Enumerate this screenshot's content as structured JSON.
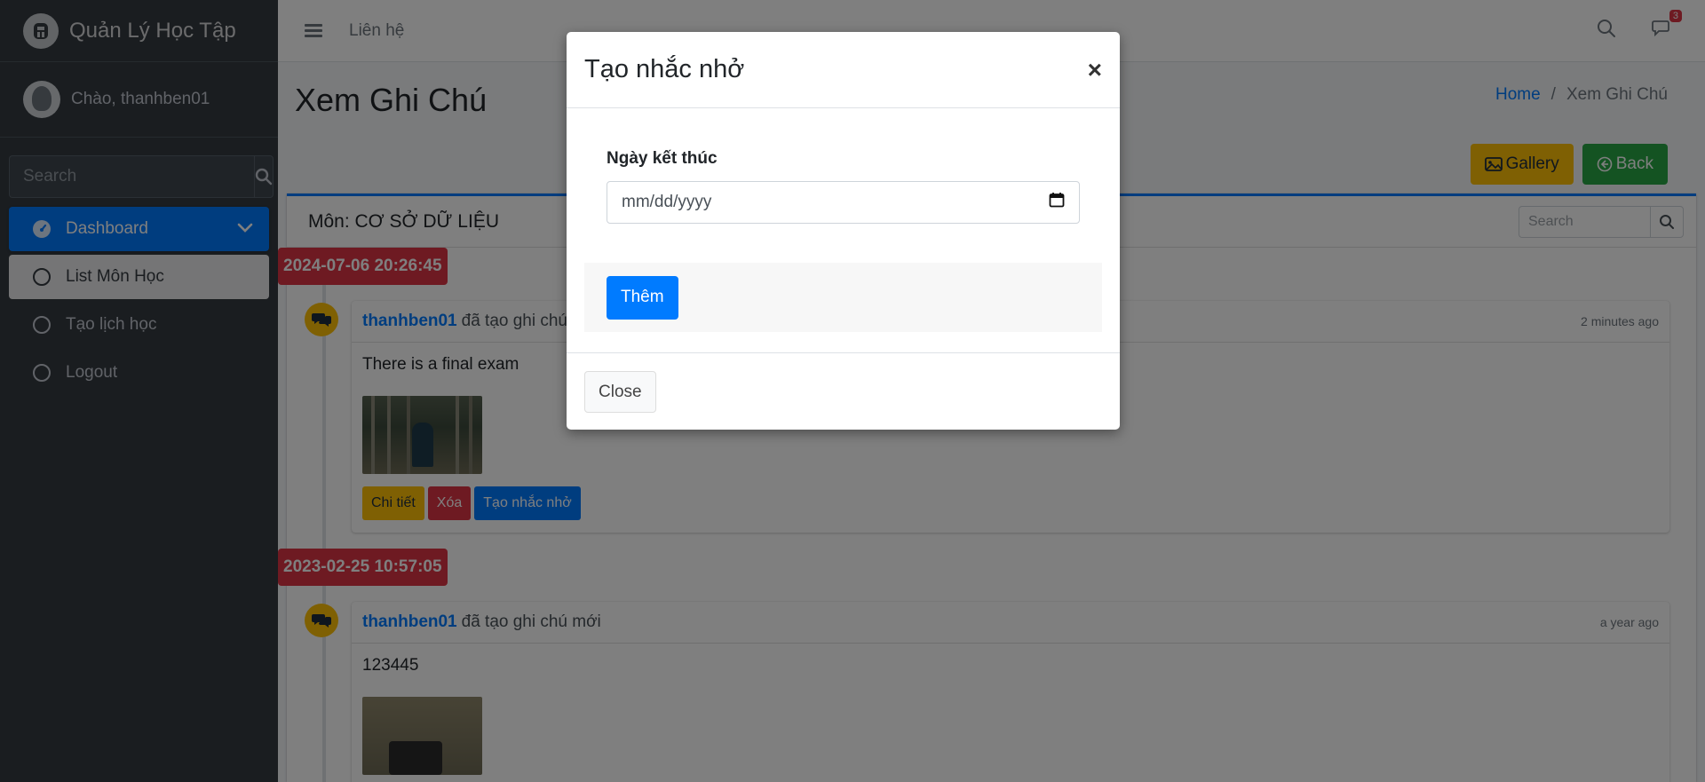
{
  "brand": {
    "name": "Quản Lý Học Tập"
  },
  "user": {
    "greeting": "Chào, thanhben01"
  },
  "sidebar": {
    "search_placeholder": "Search",
    "items": [
      {
        "label": "Dashboard",
        "icon": "tachometer-icon",
        "state": "active"
      },
      {
        "label": "List Môn Học",
        "icon": "circle-icon",
        "state": "selected"
      },
      {
        "label": "Tạo lịch học",
        "icon": "circle-icon",
        "state": "normal"
      },
      {
        "label": "Logout",
        "icon": "circle-icon",
        "state": "normal"
      }
    ]
  },
  "topbar": {
    "contact_label": "Liên hệ",
    "message_count": "3"
  },
  "page": {
    "title": "Xem Ghi Chú",
    "breadcrumb": {
      "home": "Home",
      "separator": "/",
      "current": "Xem Ghi Chú"
    },
    "gallery_label": "Gallery",
    "back_label": "Back"
  },
  "card": {
    "title": "Môn: CƠ SỞ DỮ LIỆU",
    "search_placeholder": "Search"
  },
  "timeline": [
    {
      "time_label": "2024-07-06 20:26:45",
      "author": "thanhben01",
      "action": "đã tạo ghi chú mới",
      "ago": "2 minutes ago",
      "body": "There is a final exam",
      "buttons": {
        "detail": "Chi tiết",
        "delete": "Xóa",
        "reminder": "Tạo nhắc nhở"
      }
    },
    {
      "time_label": "2023-02-25 10:57:05",
      "author": "thanhben01",
      "action": "đã tạo ghi chú mới",
      "ago": "a year ago",
      "body": "123445"
    }
  ],
  "modal": {
    "title": "Tạo nhắc nhở",
    "close_symbol": "×",
    "field_label": "Ngày kết thúc",
    "date_placeholder": "mm/dd/yyyy",
    "submit_label": "Thêm",
    "close_label": "Close"
  },
  "colors": {
    "primary": "#007bff",
    "warning": "#ffc107",
    "success": "#28a745",
    "danger": "#dc3545",
    "sidebar_bg": "#343a40"
  }
}
